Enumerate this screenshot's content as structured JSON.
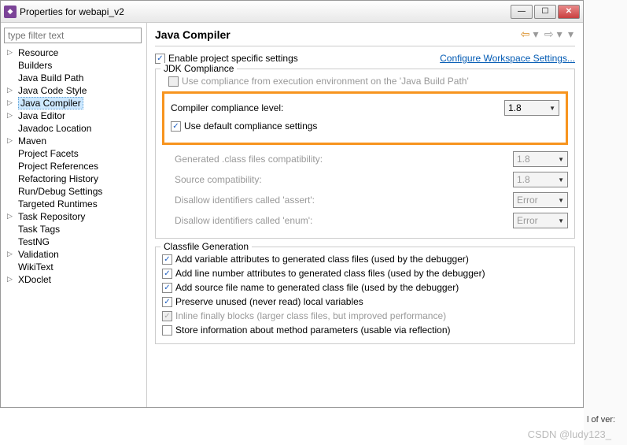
{
  "window": {
    "title": "Properties for webapi_v2"
  },
  "sidebar": {
    "filter_placeholder": "type filter text",
    "items": [
      {
        "label": "Resource",
        "children": true
      },
      {
        "label": "Builders"
      },
      {
        "label": "Java Build Path"
      },
      {
        "label": "Java Code Style",
        "children": true
      },
      {
        "label": "Java Compiler",
        "children": true,
        "selected": true
      },
      {
        "label": "Java Editor",
        "children": true
      },
      {
        "label": "Javadoc Location"
      },
      {
        "label": "Maven",
        "children": true
      },
      {
        "label": "Project Facets"
      },
      {
        "label": "Project References"
      },
      {
        "label": "Refactoring History"
      },
      {
        "label": "Run/Debug Settings"
      },
      {
        "label": "Targeted Runtimes"
      },
      {
        "label": "Task Repository",
        "children": true
      },
      {
        "label": "Task Tags"
      },
      {
        "label": "TestNG"
      },
      {
        "label": "Validation",
        "children": true
      },
      {
        "label": "WikiText"
      },
      {
        "label": "XDoclet",
        "children": true
      }
    ]
  },
  "main": {
    "title": "Java Compiler",
    "enable_specific": "Enable project specific settings",
    "configure_link": "Configure Workspace Settings...",
    "jdk_group": "JDK Compliance",
    "truncated_line": "Use compliance from execution environment on the 'Java Build Path'",
    "compliance_label": "Compiler compliance level:",
    "compliance_value": "1.8",
    "use_default": "Use default compliance settings",
    "gen_class": "Generated .class files compatibility:",
    "gen_class_val": "1.8",
    "source_compat": "Source compatibility:",
    "source_compat_val": "1.8",
    "disallow_assert": "Disallow identifiers called 'assert':",
    "disallow_assert_val": "Error",
    "disallow_enum": "Disallow identifiers called 'enum':",
    "disallow_enum_val": "Error",
    "classfile_group": "Classfile Generation",
    "cf1": "Add variable attributes to generated class files (used by the debugger)",
    "cf2": "Add line number attributes to generated class files (used by the debugger)",
    "cf3": "Add source file name to generated class file (used by the debugger)",
    "cf4": "Preserve unused (never read) local variables",
    "cf5": "Inline finally blocks (larger class files, but improved performance)",
    "cf6": "Store information about method parameters (usable via reflection)"
  },
  "watermark": "CSDN @ludy123_",
  "right_fragment": "l of ver:"
}
